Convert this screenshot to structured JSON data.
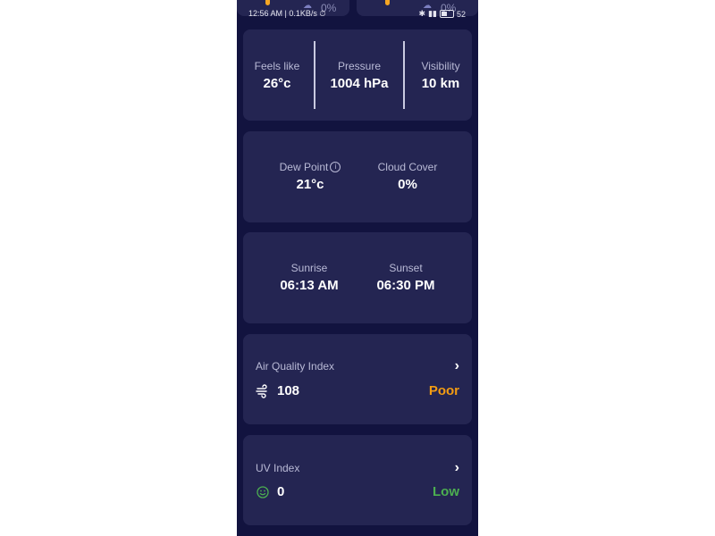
{
  "status_bar": {
    "time": "12:56 AM | 0.1KB/s",
    "battery": "52"
  },
  "top_cards": {
    "left_percent": "0%",
    "right_percent": "0%"
  },
  "details": {
    "feels_like_label": "Feels like",
    "feels_like_value": "26°c",
    "pressure_label": "Pressure",
    "pressure_value": "1004 hPa",
    "visibility_label": "Visibility",
    "visibility_value": "10 km"
  },
  "dew": {
    "dew_point_label": "Dew Point",
    "dew_point_value": "21°c",
    "cloud_cover_label": "Cloud Cover",
    "cloud_cover_value": "0%"
  },
  "sun": {
    "sunrise_label": "Sunrise",
    "sunrise_value": "06:13 AM",
    "sunset_label": "Sunset",
    "sunset_value": "06:30 PM"
  },
  "aqi": {
    "title": "Air Quality Index",
    "value": "108",
    "status": "Poor",
    "status_color": "#f39c12"
  },
  "uv": {
    "title": "UV Index",
    "value": "0",
    "status": "Low",
    "status_color": "#4caf50"
  },
  "icons": {
    "aqi": "wind-icon",
    "uv": "smiley-icon",
    "chevron": "chevron-right-icon",
    "info": "info-icon"
  }
}
